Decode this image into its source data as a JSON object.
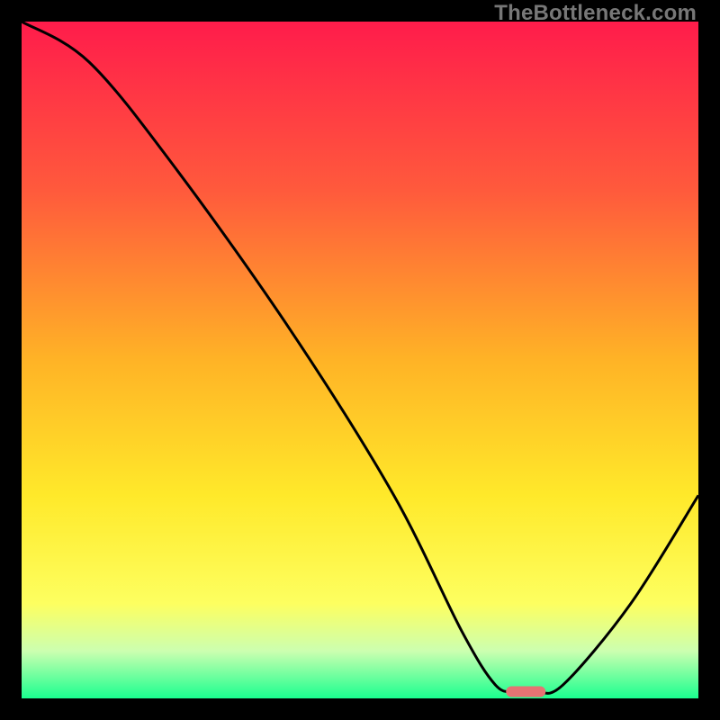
{
  "watermark": "TheBottleneck.com",
  "chart_data": {
    "type": "line",
    "title": "",
    "xlabel": "",
    "ylabel": "",
    "xlim": [
      0,
      100
    ],
    "ylim": [
      0,
      100
    ],
    "series": [
      {
        "name": "curve",
        "x": [
          0,
          10,
          23,
          40,
          55,
          65,
          70,
          73,
          76,
          80,
          90,
          100
        ],
        "y": [
          100,
          94,
          78,
          54,
          30,
          10,
          2,
          1,
          1,
          2,
          14,
          30
        ]
      }
    ],
    "annotations": [
      {
        "name": "minimum-marker",
        "x": 74.5,
        "y": 1
      }
    ],
    "background": {
      "type": "vertical-gradient",
      "stops": [
        {
          "pos": 0.0,
          "color": "#ff1c4b"
        },
        {
          "pos": 0.25,
          "color": "#ff5a3c"
        },
        {
          "pos": 0.5,
          "color": "#ffb326"
        },
        {
          "pos": 0.7,
          "color": "#ffe92a"
        },
        {
          "pos": 0.86,
          "color": "#fdff60"
        },
        {
          "pos": 0.93,
          "color": "#ccffb0"
        },
        {
          "pos": 1.0,
          "color": "#1aff8f"
        }
      ]
    },
    "marker_color": "#e57373",
    "curve_color": "#000000"
  }
}
